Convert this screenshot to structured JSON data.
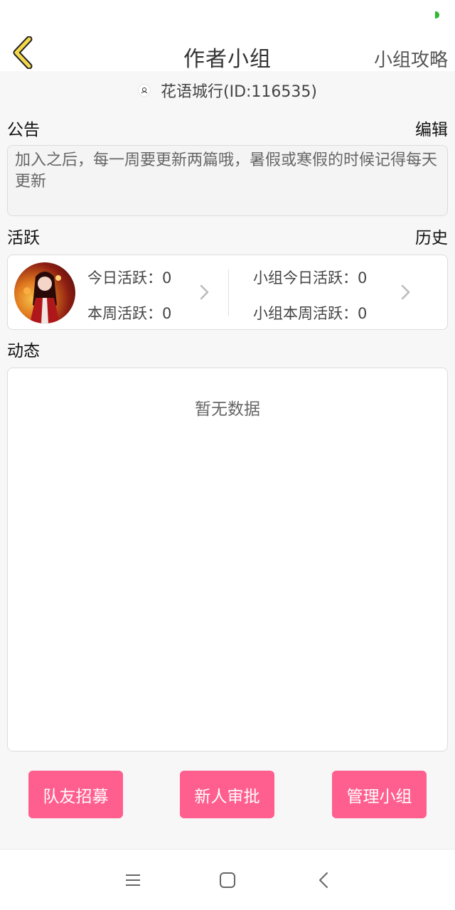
{
  "header": {
    "title": "作者小组",
    "right_link": "小组攻略"
  },
  "group": {
    "name": "花语城行(ID:116535)"
  },
  "notice": {
    "heading": "公告",
    "edit_label": "编辑",
    "text": "加入之后，每一周要更新两篇哦，暑假或寒假的时候记得每天更新"
  },
  "activity": {
    "heading": "活跃",
    "history_label": "历史",
    "personal": {
      "today": "今日活跃：0",
      "week": "本周活跃：0"
    },
    "group": {
      "today": "小组今日活跃：0",
      "week": "小组本周活跃：0"
    }
  },
  "feed": {
    "heading": "动态",
    "empty_text": "暂无数据"
  },
  "buttons": {
    "recruit": "队友招募",
    "approve": "新人审批",
    "manage": "管理小组"
  },
  "icons": {
    "back": "chevron-left-icon",
    "chevron_right": "chevron-right-icon",
    "nav_menu": "menu-icon",
    "nav_home": "square-home-icon",
    "nav_back": "back-triangle-icon"
  },
  "colors": {
    "accent": "#ff5f8f",
    "back_arrow": "#f2d84a",
    "status_dot": "#2eb82e"
  }
}
